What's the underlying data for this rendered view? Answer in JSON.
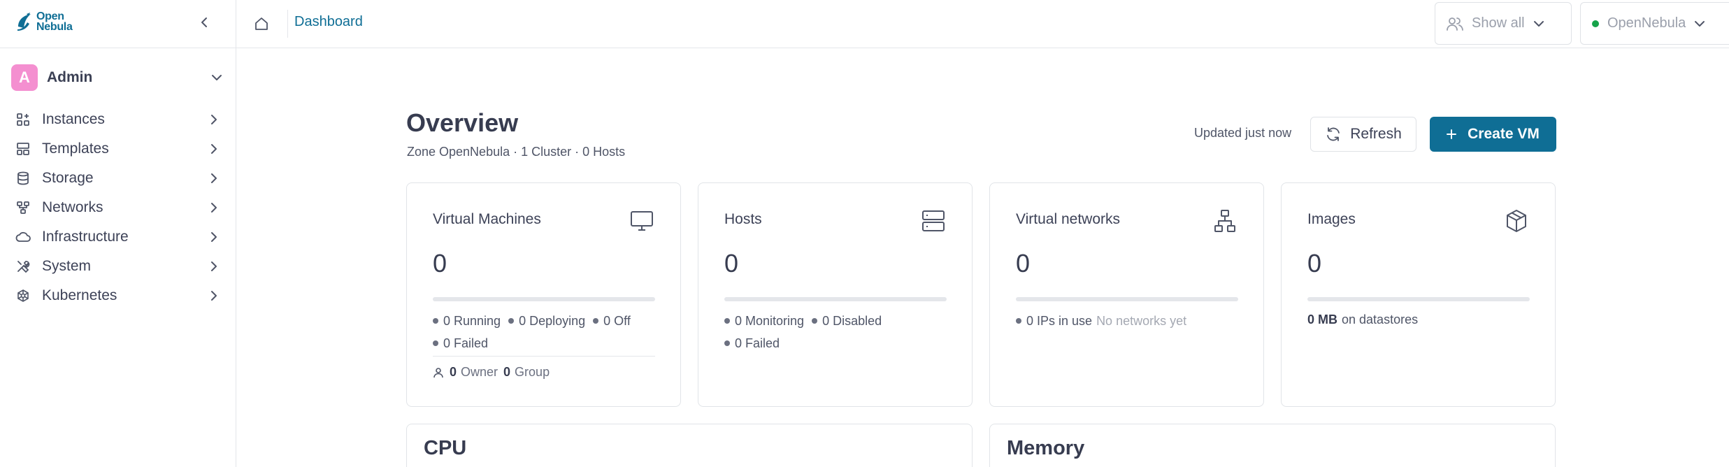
{
  "brand": {
    "line1": "Open",
    "line2": "Nebula"
  },
  "sidebar": {
    "user": {
      "initial": "A",
      "name": "Admin"
    },
    "items": [
      {
        "label": "Instances",
        "icon": "instances-icon"
      },
      {
        "label": "Templates",
        "icon": "templates-icon"
      },
      {
        "label": "Storage",
        "icon": "storage-icon"
      },
      {
        "label": "Networks",
        "icon": "networks-icon"
      },
      {
        "label": "Infrastructure",
        "icon": "cloud-icon"
      },
      {
        "label": "System",
        "icon": "tools-icon"
      },
      {
        "label": "Kubernetes",
        "icon": "kubernetes-icon"
      }
    ]
  },
  "header": {
    "breadcrumb": "Dashboard",
    "filter": {
      "label": "Show all"
    },
    "zone": {
      "label": "OpenNebula",
      "status_color": "#16a34a"
    }
  },
  "overview": {
    "title": "Overview",
    "subtitle": "Zone OpenNebula · 1 Cluster · 0 Hosts",
    "updated": "Updated just now",
    "refresh_label": "Refresh",
    "create_label": "Create VM"
  },
  "cards": {
    "vms": {
      "title": "Virtual Machines",
      "count": "0",
      "fill": 0,
      "running": "0 Running",
      "deploying": "0 Deploying",
      "off": "0 Off",
      "failed": "0 Failed",
      "owner_count": "0",
      "owner_label": "Owner",
      "group_count": "0",
      "group_label": "Group"
    },
    "hosts": {
      "title": "Hosts",
      "count": "0",
      "fill": 0,
      "monitoring": "0 Monitoring",
      "disabled": "0 Disabled",
      "failed": "0 Failed"
    },
    "vnets": {
      "title": "Virtual networks",
      "count": "0",
      "fill": 0,
      "ips": "0 IPs in use",
      "empty": "No networks yet"
    },
    "images": {
      "title": "Images",
      "count": "0",
      "fill": 0,
      "size": "0 MB",
      "size_suffix": "on datastores"
    }
  },
  "panels": {
    "cpu": "CPU",
    "memory": "Memory"
  },
  "colors": {
    "accent": "#0f6e95",
    "avatar": "#f48fd0"
  }
}
